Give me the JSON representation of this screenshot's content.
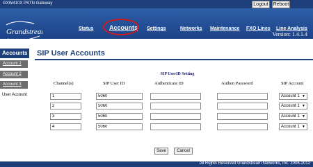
{
  "topbar": {
    "device_name": "GXW410X PSTN Gateway",
    "logout_label": "Logout",
    "reboot_label": "Reboot"
  },
  "header": {
    "logo_text": "Grandstream",
    "version": "Version: 1.4.1.4",
    "highlight_color": "#d11a1a",
    "nav": [
      "Status",
      "Accounts",
      "Settings",
      "Networks",
      "Maintenance",
      "FXO Lines",
      "Line Analysis"
    ]
  },
  "sidebar": {
    "heading": "Accounts",
    "items": [
      "Account 1",
      "Account 2",
      "Account 3"
    ],
    "plain_item": "User Account"
  },
  "main": {
    "title": "SIP User Accounts",
    "section_title": "SIP UserID Setting",
    "columns": [
      "Channel(s)",
      "SIP User ID",
      "Authenticate ID",
      "Authen Password",
      "SIP Account"
    ],
    "rows": [
      {
        "channel": "1",
        "user_id": "5060",
        "auth_id": "",
        "password": "",
        "account": "Account 1"
      },
      {
        "channel": "2",
        "user_id": "5060",
        "auth_id": "",
        "password": "",
        "account": "Account 1"
      },
      {
        "channel": "3",
        "user_id": "5060",
        "auth_id": "",
        "password": "",
        "account": "Account 1"
      },
      {
        "channel": "4",
        "user_id": "5060",
        "auth_id": "",
        "password": "",
        "account": "Account 1"
      }
    ],
    "save_label": "Save",
    "cancel_label": "Cancel"
  },
  "footer": {
    "copyright": "All Rights Reserved Grandstream Networks, Inc. 2006-2012"
  },
  "colors": {
    "brand_blue": "#1e3f7a",
    "sidebar_grey": "#6d6d6d"
  }
}
